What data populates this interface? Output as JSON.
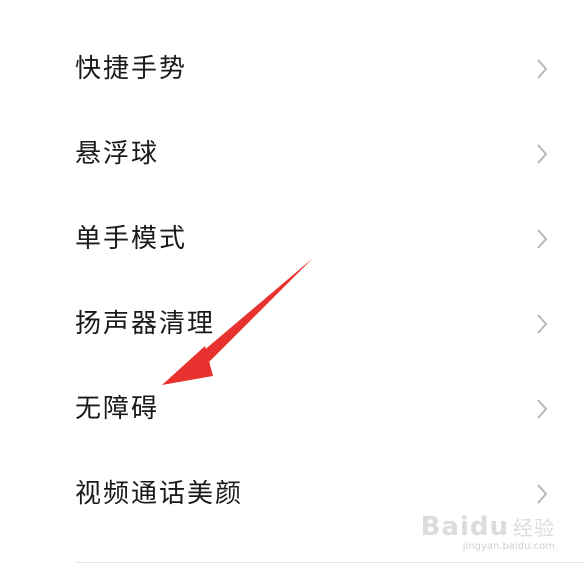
{
  "settings_list": {
    "items": [
      {
        "label": "快捷手势"
      },
      {
        "label": "悬浮球"
      },
      {
        "label": "单手模式"
      },
      {
        "label": "扬声器清理"
      },
      {
        "label": "无障碍"
      },
      {
        "label": "视频通话美颜"
      }
    ]
  },
  "watermark": {
    "logo": "Baidu",
    "logo_cn": "经验",
    "url": "jingyan.baidu.com"
  },
  "colors": {
    "text": "#1a1a1a",
    "chevron": "#b8b8b8",
    "annotation_arrow": "#e8322f",
    "divider": "#e6e6e6"
  },
  "icons": {
    "chevron": "chevron-right-icon"
  }
}
